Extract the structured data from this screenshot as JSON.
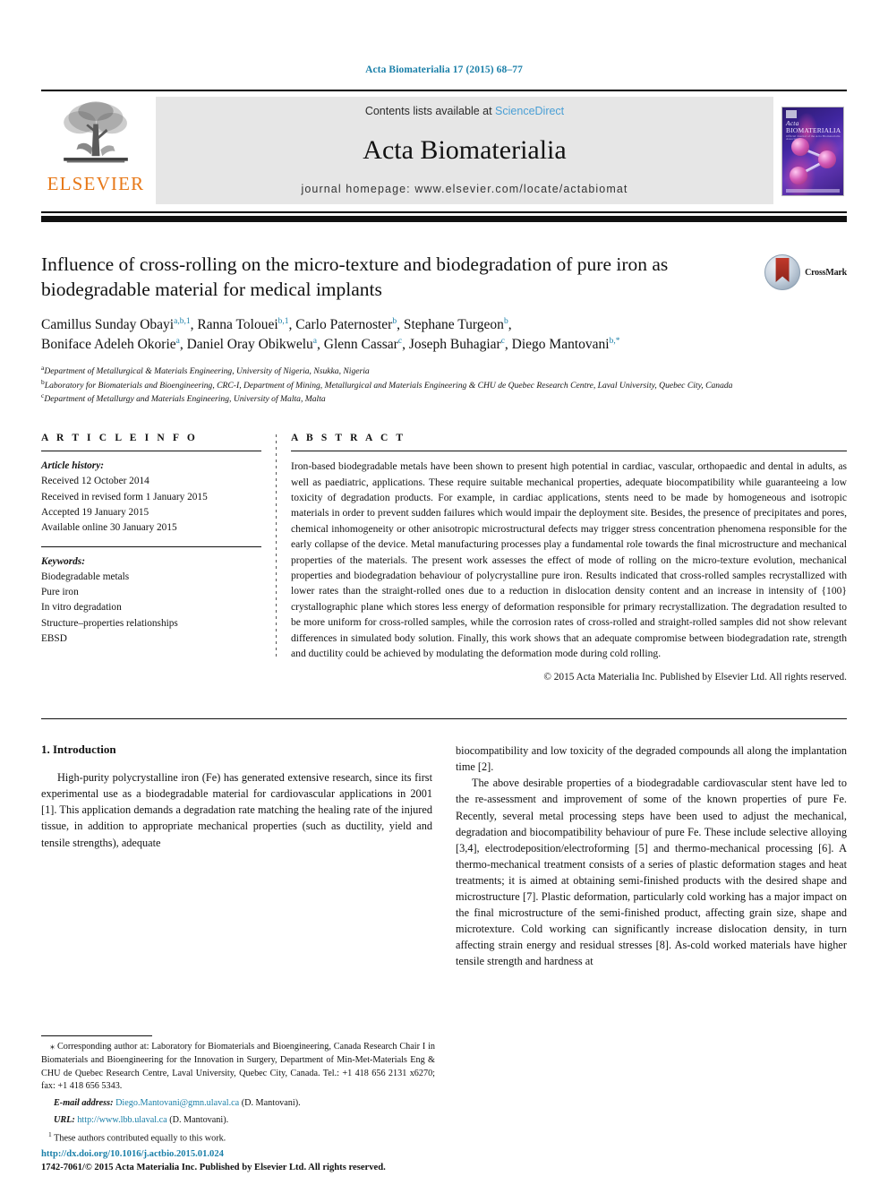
{
  "running_head": "Acta Biomaterialia 17 (2015) 68–77",
  "masthead": {
    "publisher_name": "ELSEVIER",
    "contents_prefix": "Contents lists available at ",
    "contents_link": "ScienceDirect",
    "journal_title": "Acta Biomaterialia",
    "homepage": "journal homepage: www.elsevier.com/locate/actabiomat",
    "cover_title_italic": "Acta",
    "cover_title_rest": " BIOMATERIALIA",
    "cover_subtitle": "Official Journal of the Acta Biomaterialia Association"
  },
  "article": {
    "title": "Influence of cross-rolling on the micro-texture and biodegradation of pure iron as biodegradable material for medical implants",
    "crossmark_label": "CrossMark",
    "authors_line1": "Camillus Sunday Obayi",
    "authors": [
      {
        "name": "Camillus Sunday Obayi",
        "sup": "a,b,1"
      },
      {
        "name": "Ranna Tolouei",
        "sup": "b,1"
      },
      {
        "name": "Carlo Paternoster",
        "sup": "b"
      },
      {
        "name": "Stephane Turgeon",
        "sup": "b"
      },
      {
        "name": "Boniface Adeleh Okorie",
        "sup": "a"
      },
      {
        "name": "Daniel Oray Obikwelu",
        "sup": "a"
      },
      {
        "name": "Glenn Cassar",
        "sup": "c"
      },
      {
        "name": "Joseph Buhagiar",
        "sup": "c"
      },
      {
        "name": "Diego Mantovani",
        "sup": "b,*"
      }
    ],
    "affiliations": [
      {
        "mark": "a",
        "text": "Department of Metallurgical & Materials Engineering, University of Nigeria, Nsukka, Nigeria"
      },
      {
        "mark": "b",
        "text": "Laboratory for Biomaterials and Bioengineering, CRC-I, Department of Mining, Metallurgical and Materials Engineering & CHU de Quebec Research Centre, Laval University, Quebec City, Canada"
      },
      {
        "mark": "c",
        "text": "Department of Metallurgy and Materials Engineering, University of Malta, Malta"
      }
    ]
  },
  "article_info": {
    "heading": "A R T I C L E   I N F O",
    "history_label": "Article history:",
    "history": [
      "Received 12 October 2014",
      "Received in revised form 1 January 2015",
      "Accepted 19 January 2015",
      "Available online 30 January 2015"
    ],
    "keywords_label": "Keywords:",
    "keywords": [
      "Biodegradable metals",
      "Pure iron",
      "In vitro degradation",
      "Structure–properties relationships",
      "EBSD"
    ]
  },
  "abstract": {
    "heading": "A B S T R A C T",
    "text": "Iron-based biodegradable metals have been shown to present high potential in cardiac, vascular, orthopaedic and dental in adults, as well as paediatric, applications. These require suitable mechanical properties, adequate biocompatibility while guaranteeing a low toxicity of degradation products. For example, in cardiac applications, stents need to be made by homogeneous and isotropic materials in order to prevent sudden failures which would impair the deployment site. Besides, the presence of precipitates and pores, chemical inhomogeneity or other anisotropic microstructural defects may trigger stress concentration phenomena responsible for the early collapse of the device. Metal manufacturing processes play a fundamental role towards the final microstructure and mechanical properties of the materials. The present work assesses the effect of mode of rolling on the micro-texture evolution, mechanical properties and biodegradation behaviour of polycrystalline pure iron. Results indicated that cross-rolled samples recrystallized with lower rates than the straight-rolled ones due to a reduction in dislocation density content and an increase in intensity of {100} crystallographic plane which stores less energy of deformation responsible for primary recrystallization. The degradation resulted to be more uniform for cross-rolled samples, while the corrosion rates of cross-rolled and straight-rolled samples did not show relevant differences in simulated body solution. Finally, this work shows that an adequate compromise between biodegradation rate, strength and ductility could be achieved by modulating the deformation mode during cold rolling.",
    "copyright": "© 2015 Acta Materialia Inc. Published by Elsevier Ltd. All rights reserved."
  },
  "body": {
    "section_heading": "1. Introduction",
    "left_paragraph": "High-purity polycrystalline iron (Fe) has generated extensive research, since its first experimental use as a biodegradable material for cardiovascular applications in 2001 [1]. This application demands a degradation rate matching the healing rate of the injured tissue, in addition to appropriate mechanical properties (such as ductility, yield and tensile strengths), adequate",
    "right_paragraph_1": "biocompatibility and low toxicity of the degraded compounds all along the implantation time [2].",
    "right_paragraph_2": "The above desirable properties of a biodegradable cardiovascular stent have led to the re-assessment and improvement of some of the known properties of pure Fe. Recently, several metal processing steps have been used to adjust the mechanical, degradation and biocompatibility behaviour of pure Fe. These include selective alloying [3,4], electrodeposition/electroforming [5] and thermo-mechanical processing [6]. A thermo-mechanical treatment consists of a series of plastic deformation stages and heat treatments; it is aimed at obtaining semi-finished products with the desired shape and microstructure [7]. Plastic deformation, particularly cold working has a major impact on the final microstructure of the semi-finished product, affecting grain size, shape and microtexture. Cold working can significantly increase dislocation density, in turn affecting strain energy and residual stresses [8]. As-cold worked materials have higher tensile strength and hardness at"
  },
  "footnotes": {
    "corresponding": "Corresponding author at: Laboratory for Biomaterials and Bioengineering, Canada Research Chair I in Biomaterials and Bioengineering for the Innovation in Surgery, Department of Min-Met-Materials Eng & CHU de Quebec Research Centre, Laval University, Quebec City, Canada. Tel.: +1 418 656 2131 x6270; fax: +1 418 656 5343.",
    "email_label": "E-mail address:",
    "email": "Diego.Mantovani@gmn.ulaval.ca",
    "email_attrib": "(D. Mantovani).",
    "url_label": "URL:",
    "url": "http://www.lbb.ulaval.ca",
    "url_attrib": "(D. Mantovani).",
    "contributed": "These authors contributed equally to this work."
  },
  "footer": {
    "doi": "http://dx.doi.org/10.1016/j.actbio.2015.01.024",
    "issn_line": "1742-7061/© 2015 Acta Materialia Inc. Published by Elsevier Ltd. All rights reserved."
  },
  "colors": {
    "link_blue": "#1a7fa8",
    "sciencedirect_blue": "#4a9fd5",
    "elsevier_orange": "#e77817",
    "masthead_grey": "#e6e6e6"
  }
}
